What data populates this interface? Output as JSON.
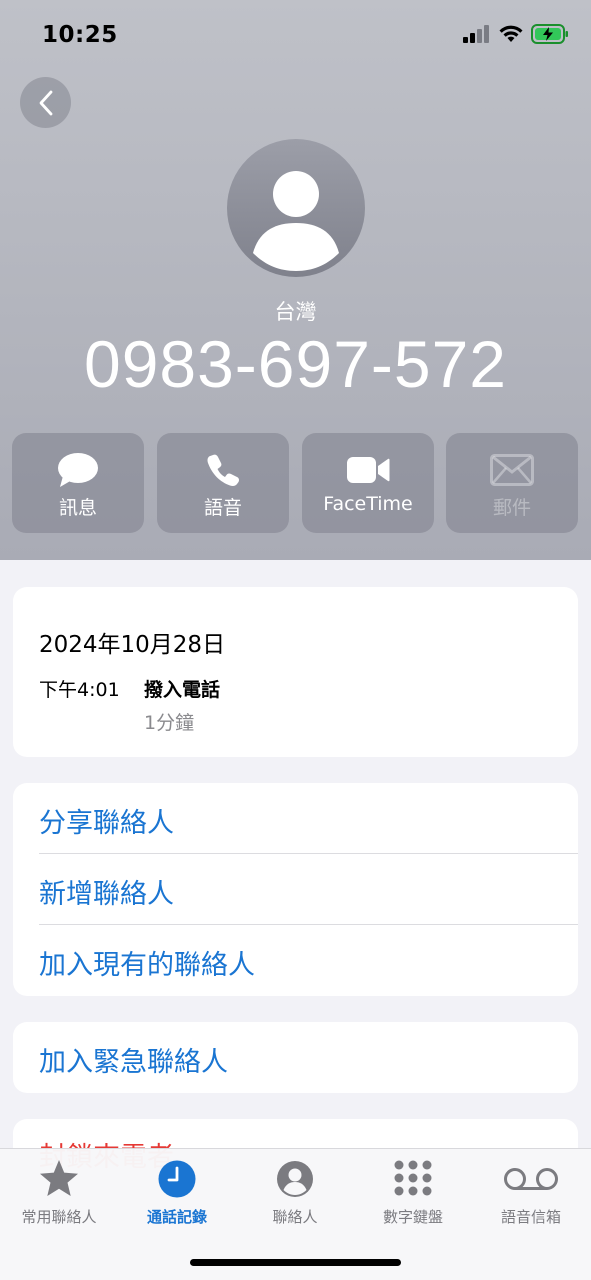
{
  "status_bar": {
    "time": "10:25"
  },
  "contact": {
    "region": "台灣",
    "phone": "0983-697-572"
  },
  "actions": [
    {
      "label": "訊息",
      "icon": "message-bubble-icon",
      "enabled": true
    },
    {
      "label": "語音",
      "icon": "phone-icon",
      "enabled": true
    },
    {
      "label": "FaceTime",
      "icon": "video-camera-icon",
      "enabled": true
    },
    {
      "label": "郵件",
      "icon": "mail-icon",
      "enabled": false
    }
  ],
  "call_log": {
    "date": "2024年10月28日",
    "time": "下午4:01",
    "type": "撥入電話",
    "duration": "1分鐘"
  },
  "contact_options": [
    {
      "label": "分享聯絡人"
    },
    {
      "label": "新增聯絡人"
    },
    {
      "label": "加入現有的聯絡人"
    }
  ],
  "emergency": {
    "label": "加入緊急聯絡人"
  },
  "block": {
    "label": "封鎖來電者"
  },
  "tabs": [
    {
      "label": "常用聯絡人",
      "icon": "star-icon",
      "active": false
    },
    {
      "label": "通話記錄",
      "icon": "clock-icon",
      "active": true
    },
    {
      "label": "聯絡人",
      "icon": "person-circle-icon",
      "active": false
    },
    {
      "label": "數字鍵盤",
      "icon": "keypad-icon",
      "active": false
    },
    {
      "label": "語音信箱",
      "icon": "voicemail-icon",
      "active": false
    }
  ],
  "colors": {
    "link_blue": "#1a75d2",
    "destructive_red": "#e53935",
    "header_gray": "#b4b6be"
  }
}
